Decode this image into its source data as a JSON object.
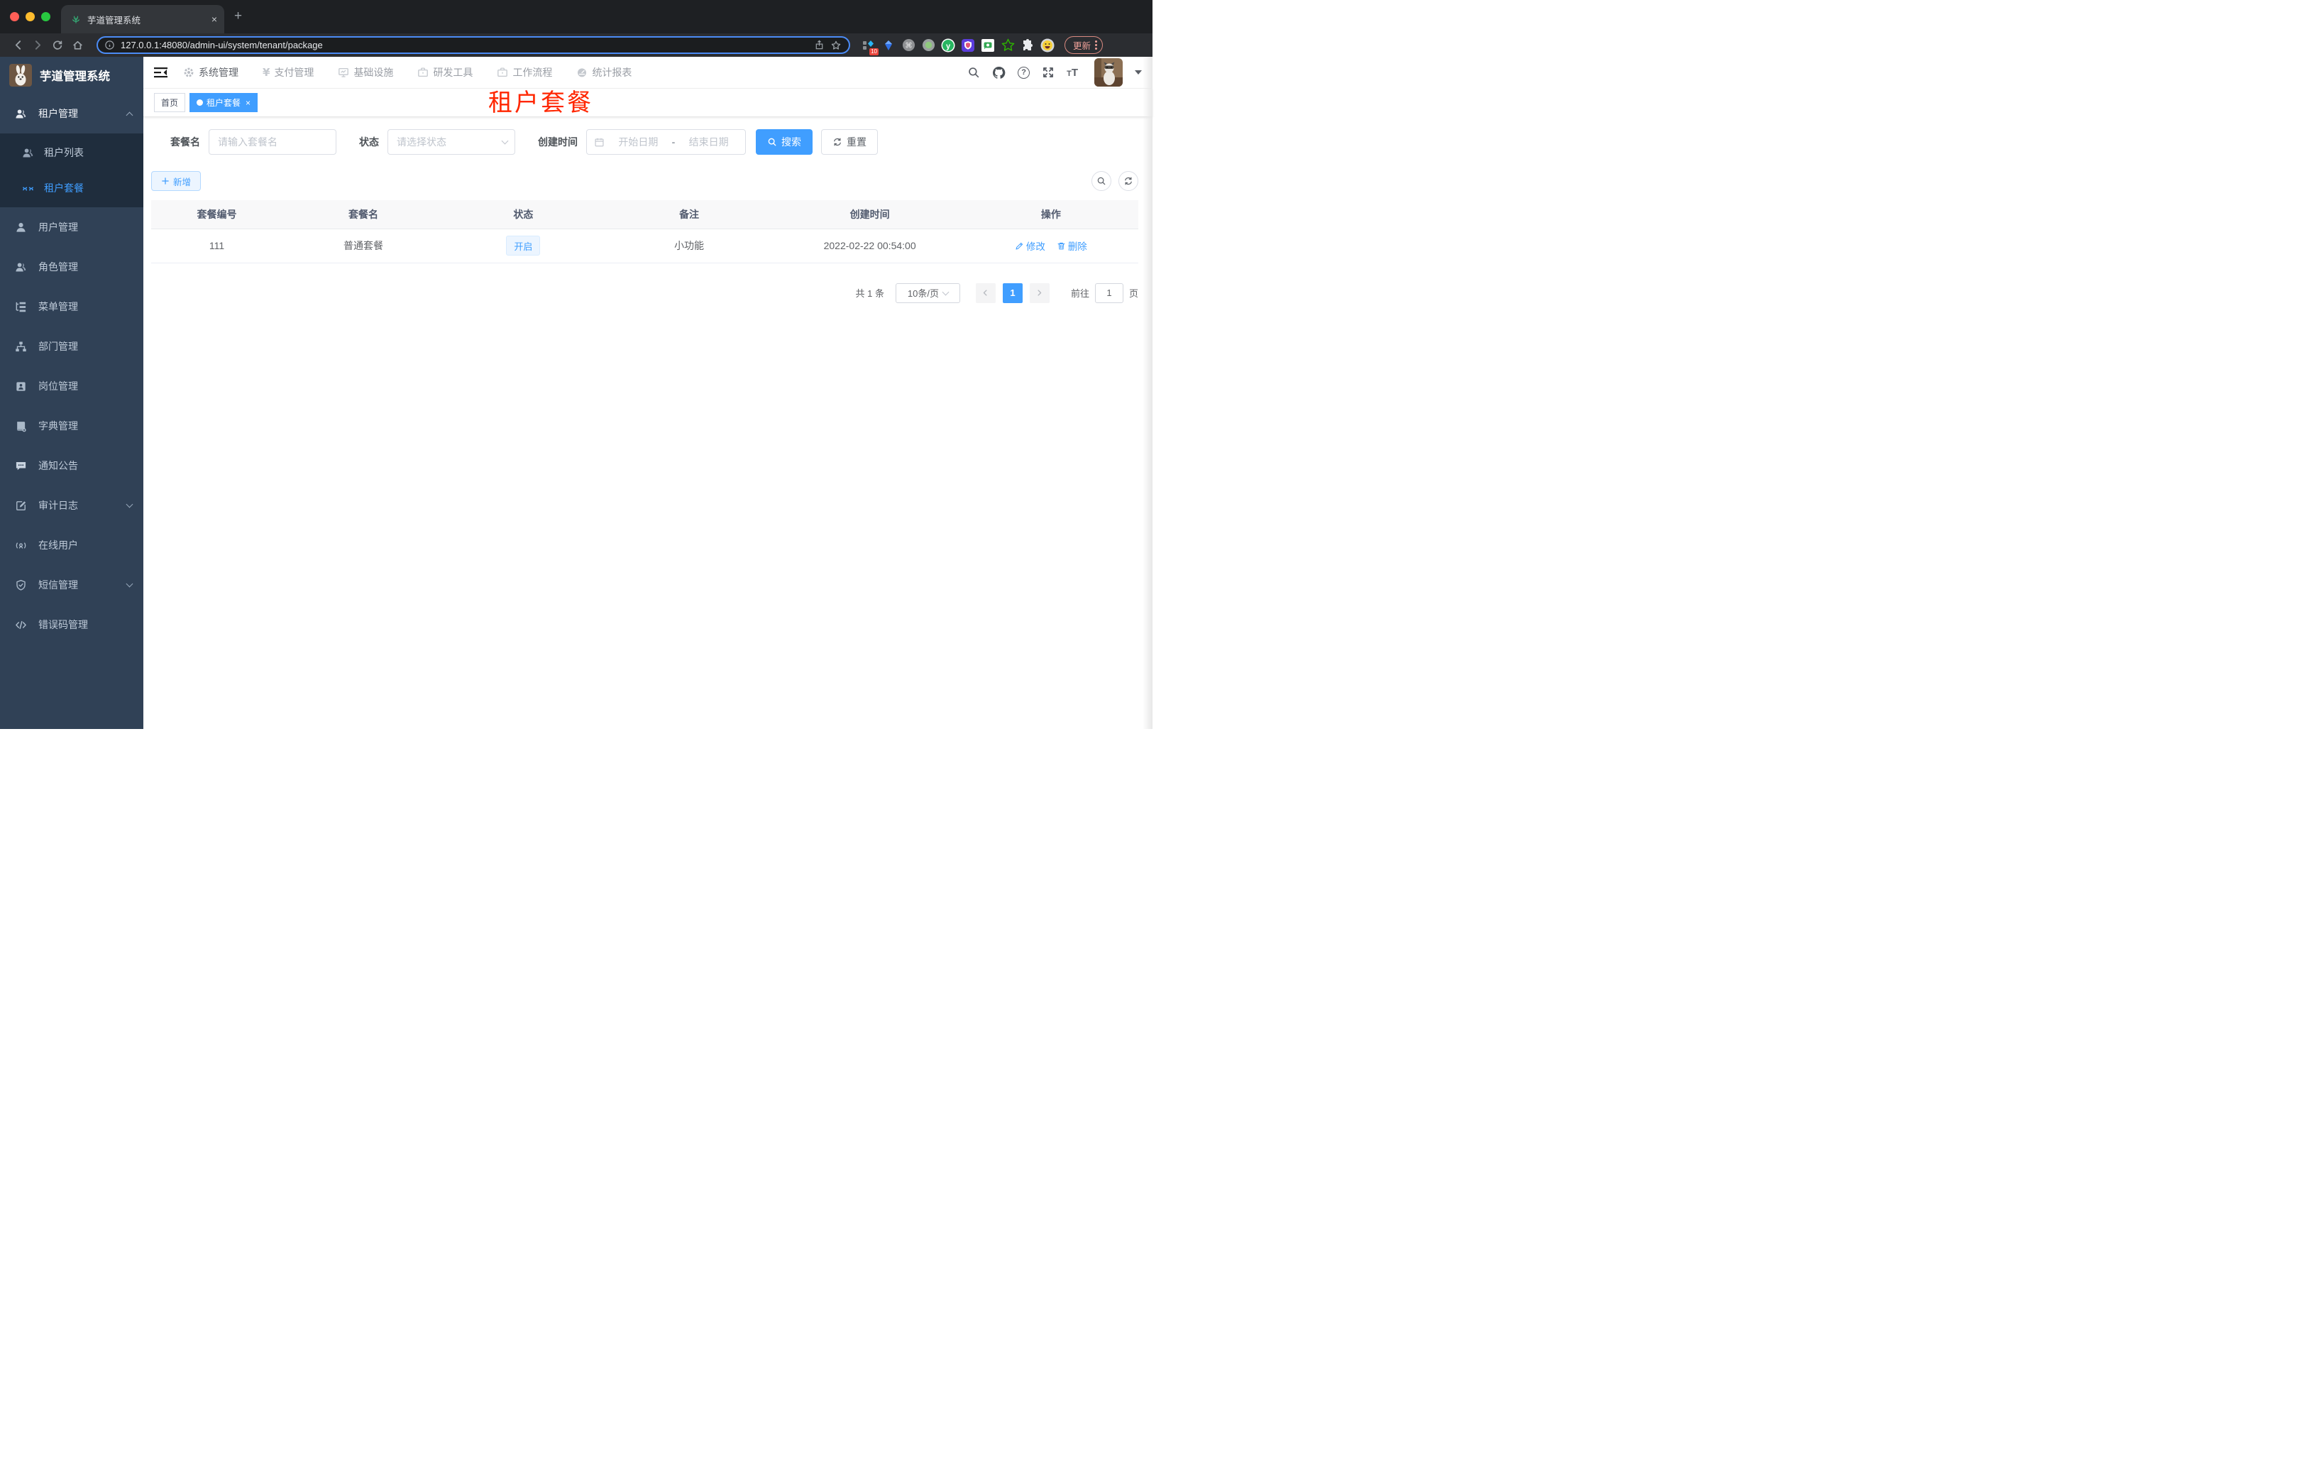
{
  "colors": {
    "accent": "#409eff",
    "annotation_red": "#ff2600",
    "sidebar_bg": "#304156",
    "submenu_bg": "#1f2d3d"
  },
  "browser": {
    "tab_title": "芋道管理系统",
    "close_tab": "×",
    "url": "127.0.0.1:48080/admin-ui/system/tenant/package",
    "extension_badge": "10",
    "update_label": "更新"
  },
  "sidebar": {
    "title": "芋道管理系统",
    "items": [
      {
        "label": "租户管理"
      },
      {
        "label": "租户列表"
      },
      {
        "label": "租户套餐"
      },
      {
        "label": "用户管理"
      },
      {
        "label": "角色管理"
      },
      {
        "label": "菜单管理"
      },
      {
        "label": "部门管理"
      },
      {
        "label": "岗位管理"
      },
      {
        "label": "字典管理"
      },
      {
        "label": "通知公告"
      },
      {
        "label": "审计日志"
      },
      {
        "label": "在线用户"
      },
      {
        "label": "短信管理"
      },
      {
        "label": "错误码管理"
      }
    ]
  },
  "nav": {
    "items": [
      "系统管理",
      "支付管理",
      "基础设施",
      "研发工具",
      "工作流程",
      "统计报表"
    ]
  },
  "tags": {
    "home": "首页",
    "active": "租户套餐",
    "close": "×"
  },
  "annotation": "租户套餐",
  "filters": {
    "name_label": "套餐名",
    "name_placeholder": "请输入套餐名",
    "status_label": "状态",
    "status_placeholder": "请选择状态",
    "time_label": "创建时间",
    "start_placeholder": "开始日期",
    "range_sep": "-",
    "end_placeholder": "结束日期",
    "search_label": "搜索",
    "reset_label": "重置"
  },
  "toolbar": {
    "add_label": "新增"
  },
  "table": {
    "columns": [
      "套餐编号",
      "套餐名",
      "状态",
      "备注",
      "创建时间",
      "操作"
    ],
    "row": {
      "id": "111",
      "name": "普通套餐",
      "status": "开启",
      "remark": "小功能",
      "created": "2022-02-22 00:54:00",
      "edit_label": "修改",
      "delete_label": "删除"
    }
  },
  "pagination": {
    "total": "共 1 条",
    "page_size": "10条/页",
    "current_page": "1",
    "goto_label": "前往",
    "goto_value": "1",
    "unit_label": "页"
  }
}
